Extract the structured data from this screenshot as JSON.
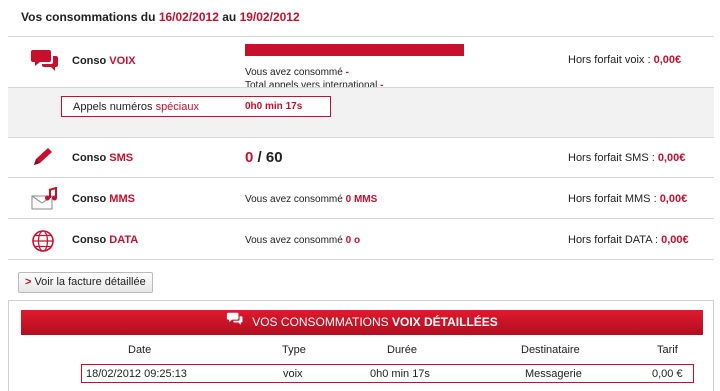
{
  "header": {
    "title_prefix": "Vos consommations du",
    "date_from": "16/02/2012",
    "connector": "au",
    "date_to": "19/02/2012"
  },
  "voice": {
    "label_prefix": "Conso",
    "label_key": "VOIX",
    "icon": "speech-bubbles-icon",
    "usage_fraction": 1.0,
    "consumed_label": "Vous avez consommé",
    "consumed_value": "-",
    "intl_label": "Total appels vers international",
    "intl_value": "-",
    "overage_label": "Hors forfait voix :",
    "overage_value": "0,00€"
  },
  "special": {
    "label_prefix": "Appels numéros",
    "label_key": "spéciaux",
    "value": "0h0 min 17s"
  },
  "sms": {
    "label_prefix": "Conso",
    "label_key": "SMS",
    "icon": "pencil-icon",
    "used": "0",
    "separator": "/",
    "total": "60",
    "overage_label": "Hors forfait SMS :",
    "overage_value": "0,00€"
  },
  "mms": {
    "label_prefix": "Conso",
    "label_key": "MMS",
    "icon": "envelope-music-icon",
    "consumed_label": "Vous avez consommé",
    "consumed_value": "0 MMS",
    "overage_label": "Hors forfait MMS :",
    "overage_value": "0,00€"
  },
  "data": {
    "label_prefix": "Conso",
    "label_key": "DATA",
    "icon": "globe-icon",
    "consumed_label": "Vous avez consommé",
    "consumed_value": "0 o",
    "overage_label": "Hors forfait DATA :",
    "overage_value": "0,00€"
  },
  "invoice_button": {
    "chevron": ">",
    "label": "Voir la facture détaillée"
  },
  "detail": {
    "banner_prefix": "VOS CONSOMMATIONS",
    "banner_key": "VOIX DÉTAILLÉES",
    "columns": [
      "Date",
      "Type",
      "Durée",
      "Destinataire",
      "Tarif"
    ],
    "rows": [
      {
        "date": "18/02/2012 09:25:13",
        "type": "voix",
        "duree": "0h0 min 17s",
        "destinataire": "Messagerie",
        "tarif": "0,00 €"
      }
    ]
  },
  "colors": {
    "accent": "#c8102e",
    "divider": "#d7d7d7",
    "shade": "#f2f2f2"
  }
}
